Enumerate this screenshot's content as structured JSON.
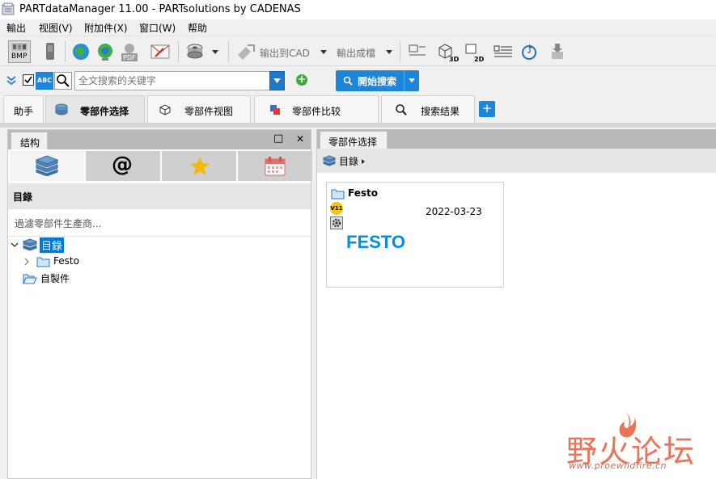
{
  "window": {
    "title": "PARTdataManager 11.00 - PARTsolutions by CADENAS"
  },
  "menu": [
    "輸出",
    "视图(V)",
    "附加件(X)",
    "窗口(W)",
    "帮助"
  ],
  "toolbar": {
    "bmp_label": "BMP",
    "pdf_label": "PDF",
    "export_cad": "输出到CAD",
    "export_drawing": "輸出成檔",
    "label_3d": "3D",
    "label_2d": "2D"
  },
  "search": {
    "abc_label": "ABC",
    "placeholder": "全文搜索的关键字",
    "start_label": "開始搜索",
    "plus_symbol": "+"
  },
  "tabs": [
    {
      "label": "助手"
    },
    {
      "label": "零部件选择",
      "active": true
    },
    {
      "label": "零部件视图"
    },
    {
      "label": "零部件比较"
    },
    {
      "label": "搜索结果"
    }
  ],
  "add_tab_symbol": "+",
  "left_panel": {
    "tab_label": "结构",
    "maximize_symbol": "□",
    "close_symbol": "✕",
    "icon_buttons": [
      "catalog-icon",
      "at-icon",
      "star-icon",
      "calendar-icon"
    ],
    "at_symbol": "@",
    "heading": "目錄",
    "filter_placeholder": "過濾零部件生產商...",
    "tree": {
      "root": "目錄",
      "children": [
        "Festo"
      ],
      "other": "自製件"
    }
  },
  "right_panel": {
    "tab_label": "零部件选择",
    "breadcrumb": "目錄",
    "card": {
      "title": "Festo",
      "version_badge": "V11",
      "date": "2022-03-23",
      "logo_text": "FESTO"
    }
  },
  "watermark": {
    "main": "野火论坛",
    "sub": "www.proewildfire.cn"
  },
  "colors": {
    "accent": "#1e86d8",
    "festo_blue": "#0091dc",
    "watermark": "#e8745a"
  }
}
